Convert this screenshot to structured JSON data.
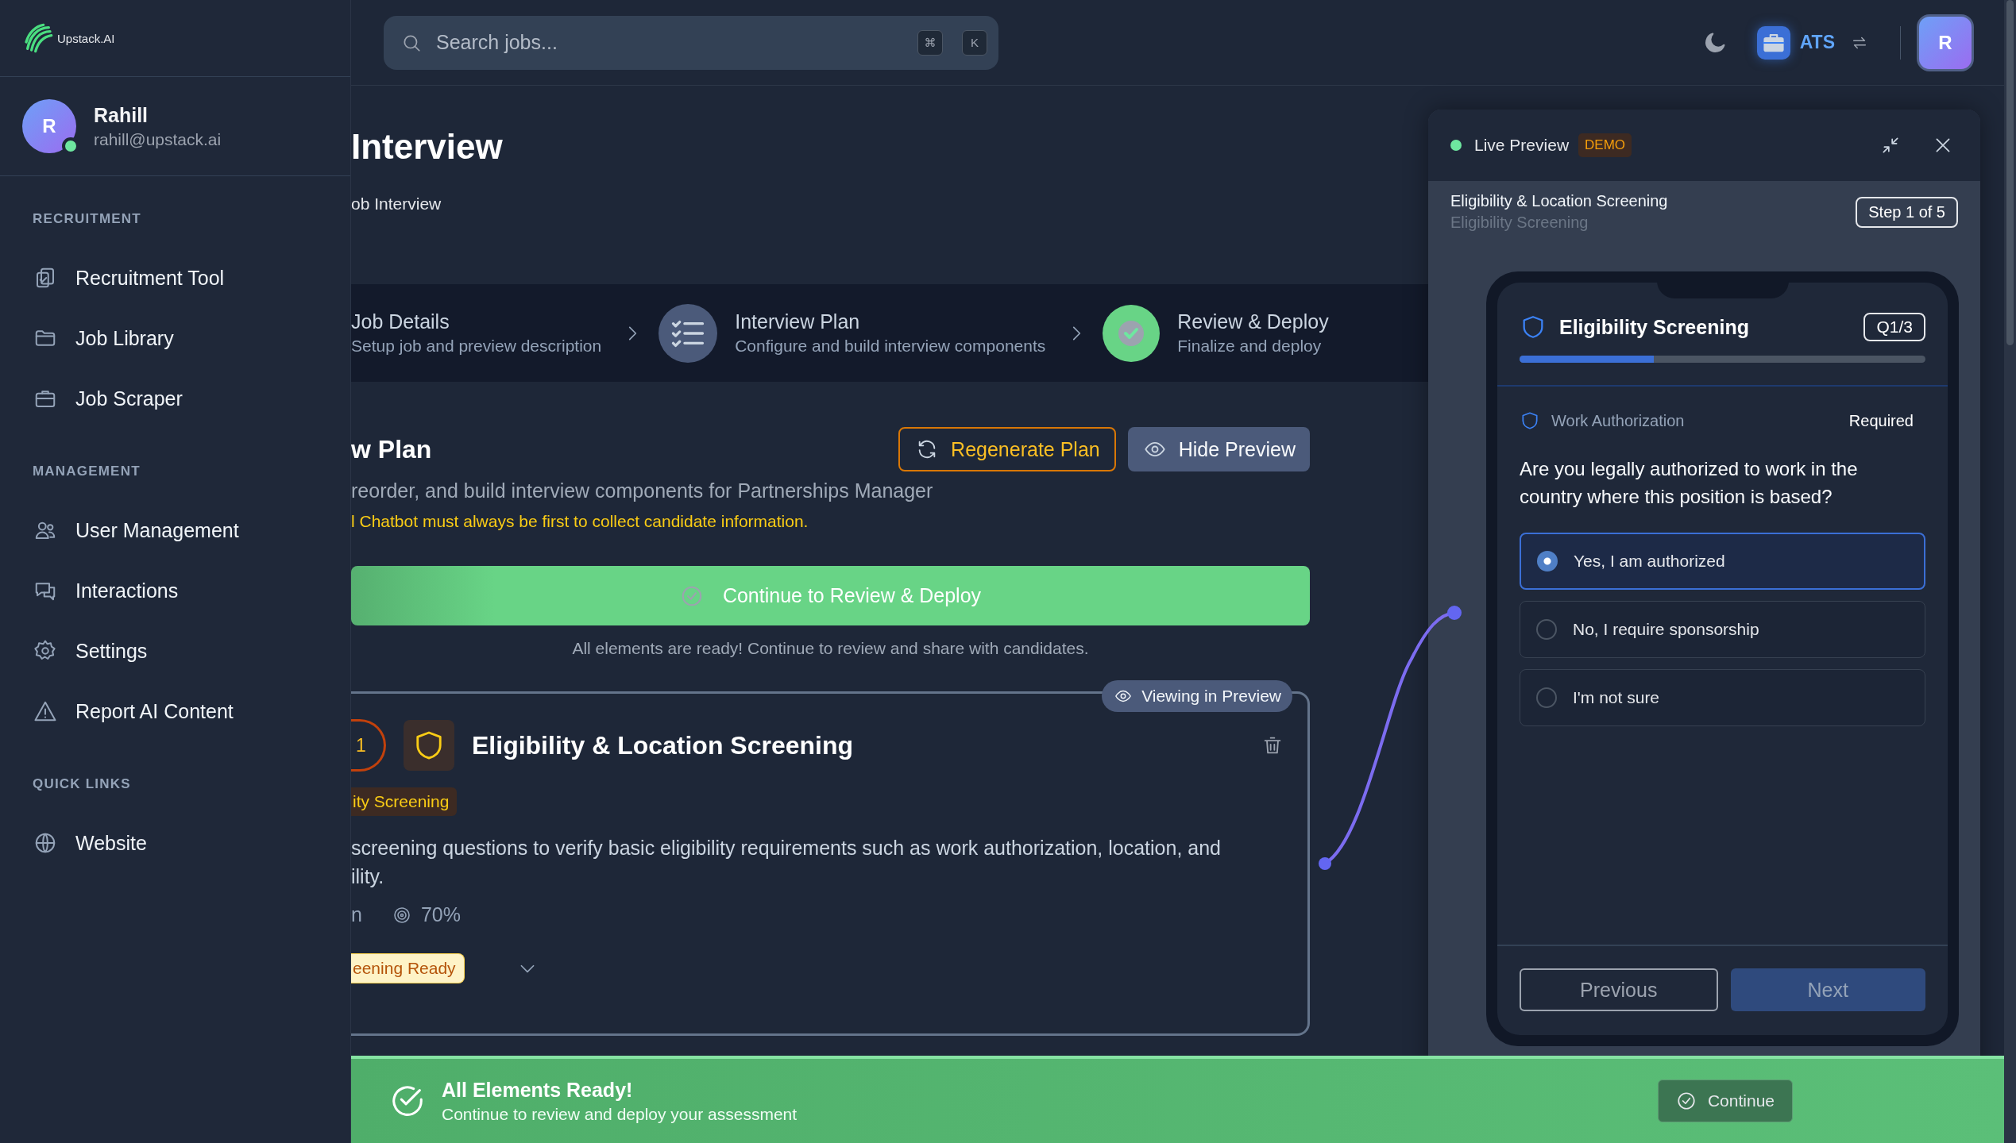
{
  "brand": {
    "name": "Upstack.AI"
  },
  "user": {
    "initial": "R",
    "name": "Rahill",
    "email": "rahill@upstack.ai",
    "online": true
  },
  "nav": [
    {
      "heading": "RECRUITMENT",
      "items": [
        "Recruitment Tool",
        "Job Library",
        "Job Scraper"
      ]
    },
    {
      "heading": "MANAGEMENT",
      "items": [
        "User Management",
        "Interactions",
        "Settings",
        "Report AI Content"
      ]
    },
    {
      "heading": "QUICK LINKS",
      "items": [
        "Website"
      ]
    }
  ],
  "header": {
    "search": {
      "placeholder": "Search jobs...",
      "keys": [
        "⌘",
        "K"
      ]
    },
    "workspace": "ATS",
    "avatar": "R"
  },
  "page": {
    "title": "Interview",
    "subtitle": "ob Interview"
  },
  "steps": [
    {
      "title": "Job Details",
      "description": "Setup job and preview description",
      "kind": "plain"
    },
    {
      "title": "Interview Plan",
      "description": "Configure and build interview components",
      "kind": "current"
    },
    {
      "title": "Review & Deploy",
      "description": "Finalize and deploy",
      "kind": "done"
    }
  ],
  "plan": {
    "title": "w Plan",
    "description": "reorder, and build interview components for Partnerships Manager",
    "warning": "l Chatbot must always be first to collect candidate information.",
    "buttons": [
      {
        "label": "Regenerate Plan",
        "kind": "outline"
      },
      {
        "label": "Hide Preview",
        "kind": "filled"
      }
    ],
    "continue_button": "Continue to Review & Deploy",
    "note": "All elements are ready! Continue to review and share with candidates."
  },
  "card": {
    "badge": "Viewing in Preview",
    "number": "1",
    "title": "Eligibility & Location Screening",
    "tag": "ity Screening",
    "description": [
      "screening questions to verify basic eligibility requirements such as work authorization, location, and",
      "ility."
    ],
    "duration": "n",
    "score": "70%",
    "status": "eening Ready",
    "expanded": false
  },
  "preview": {
    "live": true,
    "label": "Live Preview",
    "badge": "DEMO",
    "step_title": "Eligibility & Location Screening",
    "step_subtitle": "Eligibility Screening",
    "step": "Step 1 of 5",
    "section": "Eligibility Screening",
    "counter": "Q1/3",
    "level": 0.33,
    "field": "Work Authorization",
    "required": "Required",
    "question": "Are you legally authorized to work in the country where this position is based?",
    "options": [
      {
        "label": "Yes, I am authorized",
        "selected": true
      },
      {
        "label": "No, I require sponsorship",
        "selected": false
      },
      {
        "label": "I'm not sure",
        "selected": false
      }
    ],
    "previous": "Previous",
    "next": "Next"
  },
  "banner": {
    "title": "All Elements Ready!",
    "subtitle": "Continue to review and deploy your assessment",
    "button": "Continue"
  }
}
